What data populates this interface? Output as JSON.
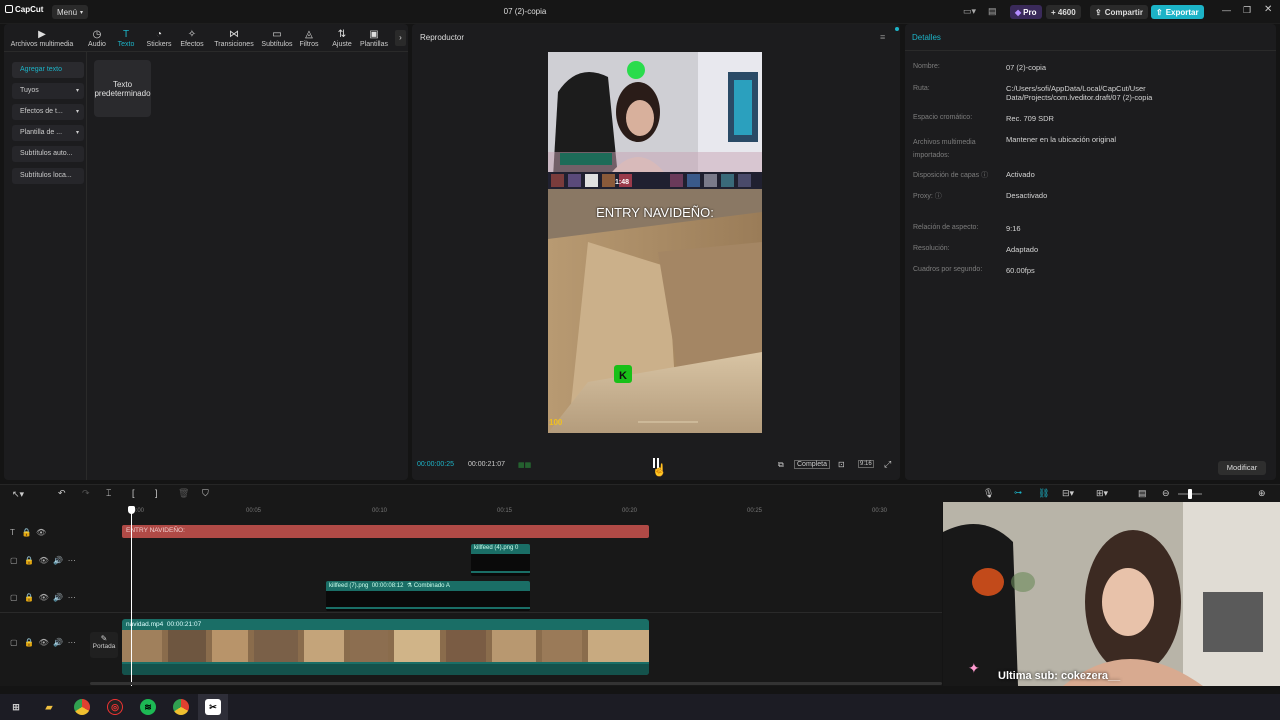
{
  "titlebar": {
    "logo": "CapCut",
    "menu": "Menú",
    "project_title": "07 (2)-copia",
    "pro": "Pro",
    "credits": "+ 4600",
    "share": "Compartir",
    "export": "Exportar",
    "accent": "#1cb3c7"
  },
  "toolbar": {
    "items": [
      "Archivos multimedia",
      "Audio",
      "Texto",
      "Stickers",
      "Efectos",
      "Transiciones",
      "Subtítulos",
      "Filtros",
      "Ajuste",
      "Plantillas"
    ],
    "active": "Texto"
  },
  "sidenav": {
    "items": [
      "Agregar texto",
      "Tuyos",
      "Efectos de t...",
      "Plantilla de ...",
      "Subtítulos auto...",
      "Subtítulos loca..."
    ]
  },
  "text_card": {
    "label": "Texto predeterminado"
  },
  "player": {
    "title": "Reproductor",
    "overlay_text": "ENTRY NAVIDEÑO:",
    "current_time": "00:00:00:25",
    "total_time": "00:00:21:07",
    "ratio_label": "Completa",
    "aspect_btn": "9:16",
    "score": "1:48",
    "hud_left": "100"
  },
  "details": {
    "title": "Detalles",
    "modify": "Modificar",
    "rows": [
      {
        "label": "Nombre:",
        "value": "07 (2)-copia"
      },
      {
        "label": "Ruta:",
        "value": "C:/Users/sofi/AppData/Local/CapCut/User Data/Projects/com.lveditor.draft/07 (2)-copia"
      },
      {
        "label": "Espacio cromático:",
        "value": "Rec. 709 SDR"
      },
      {
        "label": "Archivos multimedia importados:",
        "value": "Mantener en la ubicación original"
      },
      {
        "label": "Disposición de capas",
        "value": "Activado"
      },
      {
        "label": "Proxy:",
        "value": "Desactivado"
      },
      {
        "label": "Relación de aspecto:",
        "value": "9:16"
      },
      {
        "label": "Resolución:",
        "value": "Adaptado"
      },
      {
        "label": "Cuadros por segundo:",
        "value": "60.00fps"
      }
    ]
  },
  "timeline": {
    "ticks": [
      "00:00",
      "00:05",
      "00:10",
      "00:15",
      "00:20",
      "00:25",
      "00:30"
    ],
    "text_clip": "ENTRY NAVIDEÑO:",
    "clip_a": "killfeed (4).png  0",
    "clip_b_name": "killfeed (7).png",
    "clip_b_time": "00:00:08:12",
    "clip_b_effect": "Combinado A",
    "video_clip_name": "navidad.mp4",
    "video_clip_time": "00:00:21:07",
    "cover": "Portada"
  },
  "webcam": {
    "caption": "Ultima sub: cokezera__"
  }
}
